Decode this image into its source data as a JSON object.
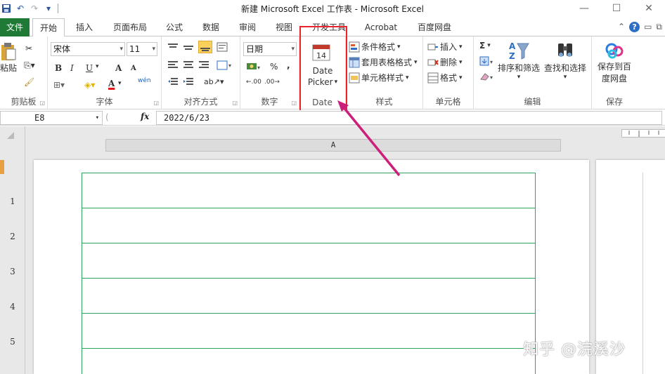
{
  "window": {
    "title": "新建 Microsoft Excel 工作表 - Microsoft Excel"
  },
  "tabs": [
    {
      "label": "文件"
    },
    {
      "label": "开始"
    },
    {
      "label": "插入"
    },
    {
      "label": "页面布局"
    },
    {
      "label": "公式"
    },
    {
      "label": "数据"
    },
    {
      "label": "审阅"
    },
    {
      "label": "视图"
    },
    {
      "label": "开发工具"
    },
    {
      "label": "Acrobat"
    },
    {
      "label": "百度网盘"
    }
  ],
  "clipboard": {
    "paste_label": "粘贴",
    "group_label": "剪贴板"
  },
  "font": {
    "name": "宋体",
    "size": "11",
    "bold": "B",
    "italic": "I",
    "underline": "U",
    "grow": "A",
    "shrink": "A",
    "color_a": "A",
    "phonetic": "wén",
    "group_label": "字体"
  },
  "alignment": {
    "group_label": "对齐方式"
  },
  "number": {
    "format": "日期",
    "percent": "%",
    "comma": ",",
    "inc_decimal": ".00",
    "dec_decimal": ".00",
    "group_label": "数字"
  },
  "date": {
    "calendar_day": "14",
    "button_line1": "Date",
    "button_line2": "Picker",
    "group_label": "Date"
  },
  "styles": {
    "cond_format": "条件格式",
    "table_format": "套用表格格式",
    "cell_styles": "单元格样式",
    "group_label": "样式"
  },
  "cells": {
    "insert": "插入",
    "delete": "删除",
    "format": "格式",
    "group_label": "单元格"
  },
  "editing": {
    "sigma": "Σ",
    "sort_filter": "排序和筛选",
    "find_select": "查找和选择",
    "group_label": "编辑"
  },
  "save": {
    "label_line1": "保存到百",
    "label_line2": "度网盘",
    "group_label": "保存"
  },
  "formula_bar": {
    "name_box": "E8",
    "fx": "fx",
    "formula": "2022/6/23"
  },
  "sheet": {
    "column_header": "A",
    "rows": [
      "1",
      "2",
      "3",
      "4",
      "5"
    ]
  },
  "watermark": "知乎 @浣溪沙",
  "colors": {
    "accent_green": "#1f7a35",
    "highlight_red": "#e8242c",
    "arrow_magenta": "#cc1f7a",
    "grid_green": "#2ea35a"
  }
}
